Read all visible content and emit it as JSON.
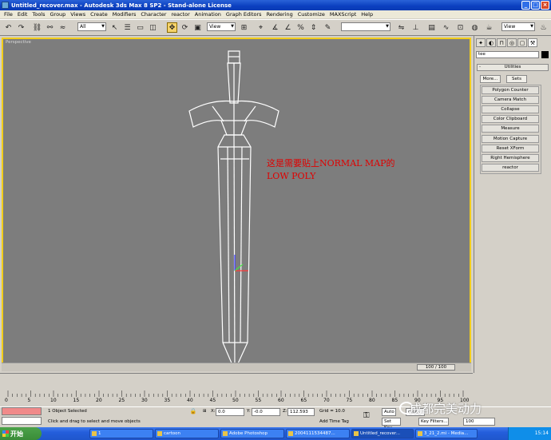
{
  "window": {
    "title": "Untitled_recover.max - Autodesk 3ds Max 8 SP2 - Stand-alone License",
    "btn_min": "_",
    "btn_max": "□",
    "btn_close": "×"
  },
  "menus": [
    "File",
    "Edit",
    "Tools",
    "Group",
    "Views",
    "Create",
    "Modifiers",
    "Character",
    "reactor",
    "Animation",
    "Graph Editors",
    "Rendering",
    "Customize",
    "MAXScript",
    "Help"
  ],
  "toolbar": {
    "selection_filter": "All",
    "ref_coord": "View",
    "named_selection": ""
  },
  "viewport": {
    "label": "Perspective",
    "annotation_line1": "这是需要贴上NORMAL MAP的",
    "annotation_line2": "LOW POLY",
    "frame_counter": "100 / 100"
  },
  "command_panel": {
    "name_field": "tee",
    "rollout_title": "Utilities",
    "minus": "-",
    "more_button": "More...",
    "sets_button": "Sets",
    "utilities": [
      "Polygon Counter",
      "Camera Match",
      "Collapse",
      "Color Clipboard",
      "Measure",
      "Motion Capture",
      "Reset XForm",
      "Right Hemisphere",
      "reactor"
    ],
    "view_select": "View"
  },
  "timeline": {
    "ticks": [
      "0",
      "5",
      "10",
      "15",
      "20",
      "25",
      "30",
      "35",
      "40",
      "45",
      "50",
      "55",
      "60",
      "65",
      "70",
      "75",
      "80",
      "85",
      "90",
      "95",
      "100"
    ]
  },
  "status": {
    "selection_count": "1 Object Selected",
    "prompt": "Click and drag to select and move objects",
    "x_label": "X:",
    "x_value": "0.0",
    "y_label": "Y:",
    "y_value": "-0.0",
    "z_label": "Z:",
    "z_value": "112.593",
    "grid": "Grid = 10.0",
    "add_time_tag": "Add Time Tag",
    "auto_key": "Auto",
    "set_key": "Set Key",
    "selected": "cted",
    "key_filters": "Key Filters...",
    "frame_field": "100"
  },
  "taskbar": {
    "start": "开始",
    "items": [
      "1",
      "cartoon",
      "Adobe Photoshop",
      "2004111534487...",
      "Untitled_recover...",
      "3_21_2.mi - Media..."
    ],
    "clock": "15:14"
  },
  "watermark": "成都完美动力",
  "colors": {
    "viewport_bg": "#7d7d7d",
    "active_border": "#f2cd1a",
    "annotation": "#e00000",
    "titlebar": "#0b3fbf"
  }
}
